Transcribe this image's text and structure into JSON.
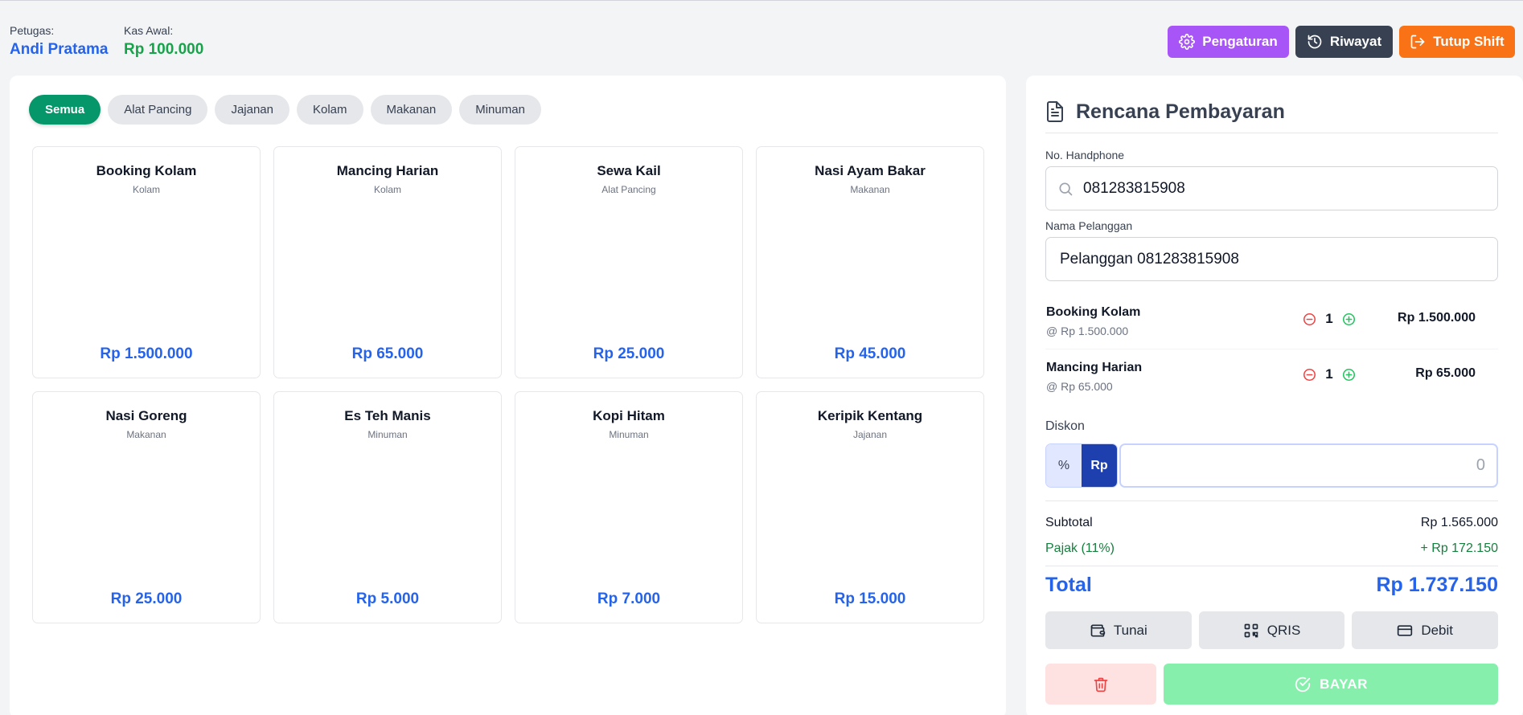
{
  "header": {
    "staff_label": "Petugas:",
    "staff_name": "Andi Pratama",
    "cash_label": "Kas Awal:",
    "cash_value": "Rp 100.000",
    "buttons": {
      "settings": "Pengaturan",
      "history": "Riwayat",
      "close_shift": "Tutup Shift"
    }
  },
  "categories": [
    "Semua",
    "Alat Pancing",
    "Jajanan",
    "Kolam",
    "Makanan",
    "Minuman"
  ],
  "active_category": "Semua",
  "products": [
    {
      "name": "Booking Kolam",
      "category": "Kolam",
      "price": "Rp 1.500.000"
    },
    {
      "name": "Mancing Harian",
      "category": "Kolam",
      "price": "Rp 65.000"
    },
    {
      "name": "Sewa Kail",
      "category": "Alat Pancing",
      "price": "Rp 25.000"
    },
    {
      "name": "Nasi Ayam Bakar",
      "category": "Makanan",
      "price": "Rp 45.000"
    },
    {
      "name": "Nasi Goreng",
      "category": "Makanan",
      "price": "Rp 25.000"
    },
    {
      "name": "Es Teh Manis",
      "category": "Minuman",
      "price": "Rp 5.000"
    },
    {
      "name": "Kopi Hitam",
      "category": "Minuman",
      "price": "Rp 7.000"
    },
    {
      "name": "Keripik Kentang",
      "category": "Jajanan",
      "price": "Rp 15.000"
    }
  ],
  "payment_panel": {
    "title": "Rencana Pembayaran",
    "phone_label": "No. Handphone",
    "phone_value": "081283815908",
    "customer_label": "Nama Pelanggan",
    "customer_value": "Pelanggan 081283815908",
    "cart": [
      {
        "name": "Booking Kolam",
        "unit_price": "@ Rp 1.500.000",
        "qty": "1",
        "total": "Rp 1.500.000"
      },
      {
        "name": "Mancing Harian",
        "unit_price": "@ Rp 65.000",
        "qty": "1",
        "total": "Rp 65.000"
      }
    ],
    "discount_label": "Diskon",
    "discount_percent": "%",
    "discount_rp": "Rp",
    "discount_value": "0",
    "subtotal_label": "Subtotal",
    "subtotal_value": "Rp 1.565.000",
    "tax_label": "Pajak (11%)",
    "tax_value": "+ Rp 172.150",
    "total_label": "Total",
    "total_value": "Rp 1.737.150",
    "methods": [
      "Tunai",
      "QRIS",
      "Debit"
    ],
    "pay_label": "BAYAR"
  },
  "colors": {
    "accent_blue": "#2563eb",
    "active_category": "#059669",
    "settings_btn": "#a855f7",
    "history_btn": "#374151",
    "close_shift_btn": "#f97316",
    "pay_btn": "#86efac"
  },
  "icons": {
    "settings": "gear-icon",
    "history": "history-icon",
    "close_shift": "logout-icon",
    "title": "document-icon",
    "phone": "search-icon",
    "minus": "minus-circle-icon",
    "plus": "plus-circle-icon",
    "cash": "wallet-icon",
    "qris": "qr-code-icon",
    "debit": "credit-card-icon",
    "delete": "trash-icon",
    "pay": "check-circle-icon"
  }
}
